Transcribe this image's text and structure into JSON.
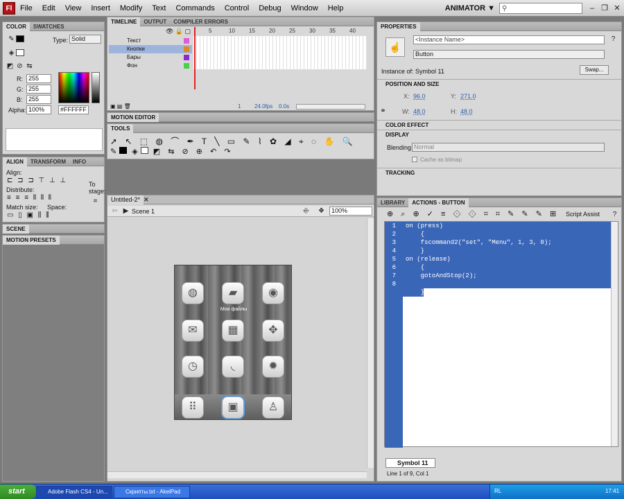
{
  "menu": {
    "logo": "Fl",
    "items": [
      "File",
      "Edit",
      "View",
      "Insert",
      "Modify",
      "Text",
      "Commands",
      "Control",
      "Debug",
      "Window",
      "Help"
    ],
    "workspace": "ANIMATOR ▼",
    "search_placeholder": ""
  },
  "color_panel": {
    "tabs": [
      "COLOR",
      "SWATCHES"
    ],
    "type_label": "Type:",
    "type_value": "Solid",
    "r_label": "R:",
    "r": "255",
    "g_label": "G:",
    "g": "255",
    "b_label": "B:",
    "b": "255",
    "alpha_label": "Alpha:",
    "alpha": "100%",
    "hex": "#FFFFFF"
  },
  "align_panel": {
    "tabs": [
      "ALIGN",
      "TRANSFORM",
      "INFO"
    ],
    "align": "Align:",
    "distribute": "Distribute:",
    "match_size": "Match size:",
    "space": "Space:",
    "to_stage": "To stage:"
  },
  "scene_panel": {
    "title": "SCENE"
  },
  "motion_presets": {
    "title": "MOTION PRESETS"
  },
  "timeline": {
    "tabs": [
      "TIMELINE",
      "OUTPUT",
      "COMPILER ERRORS"
    ],
    "frame_numbers": [
      "5",
      "10",
      "15",
      "20",
      "25",
      "30",
      "35",
      "40"
    ],
    "layers": [
      {
        "name": "Текст",
        "color": "#e25ad8"
      },
      {
        "name": "Кнопки",
        "color": "#e08a1a"
      },
      {
        "name": "Бары",
        "color": "#8a2bd0"
      },
      {
        "name": "Фон",
        "color": "#4bd04b"
      }
    ],
    "frame": "1",
    "fps": "24.0fps",
    "time": "0.0s"
  },
  "motion_editor": {
    "title": "MOTION EDITOR"
  },
  "tools": {
    "title": "TOOLS"
  },
  "document": {
    "tab": "Untitled-2*",
    "scene": "Scene 1",
    "zoom": "100%"
  },
  "phone": {
    "icons": [
      "globe-icon",
      "folder-icon",
      "disc-icon",
      "chat-icon",
      "grid-icon",
      "gamepad-icon",
      "clock-icon",
      "rss-icon",
      "gear-icon"
    ],
    "folder_caption": "Мои файлы",
    "dock": [
      "apps-icon",
      "photo-icon",
      "person-icon"
    ]
  },
  "properties": {
    "title": "PROPERTIES",
    "instance_name_placeholder": "<Instance Name>",
    "type": "Button",
    "instance_of": "Instance of:  Symbol 11",
    "swap": "Swap...",
    "position_header": "POSITION AND SIZE",
    "x_label": "X:",
    "x": "96.0",
    "y_label": "Y:",
    "y": "271.0",
    "w_label": "W:",
    "w": "48.0",
    "h_label": "H:",
    "h": "48.0",
    "color_effect": "COLOR EFFECT",
    "display": "DISPLAY",
    "blending_label": "Blending:",
    "blending": "Normal",
    "cache_label": "Cache as bitmap",
    "tracking": "TRACKING"
  },
  "actions": {
    "tabs": [
      "LIBRARY",
      "ACTIONS - BUTTON"
    ],
    "script_assist": "Script Assist",
    "lines": [
      "on (press)",
      "    {",
      "    fscommand2(\"set\", \"Menu\", 1, 3, 0);",
      "    }",
      "on (release)",
      "    {",
      "    gotoAndStop(2);",
      "",
      "    }"
    ],
    "line_numbers": [
      "1",
      "2",
      "3",
      "4",
      "5",
      "6",
      "7",
      "8",
      "9"
    ],
    "symbol_tab": "Symbol 11",
    "status": "Line 1 of 9, Col 1"
  },
  "taskbar": {
    "start": "start",
    "tasks": [
      "Adobe Flash CS4 - Un...",
      "Скрипты.txt - AkelPad"
    ],
    "lang": "RL",
    "time": "17:41"
  },
  "colors": {
    "selection": "#3a66b8",
    "accent": "#b3141a"
  }
}
